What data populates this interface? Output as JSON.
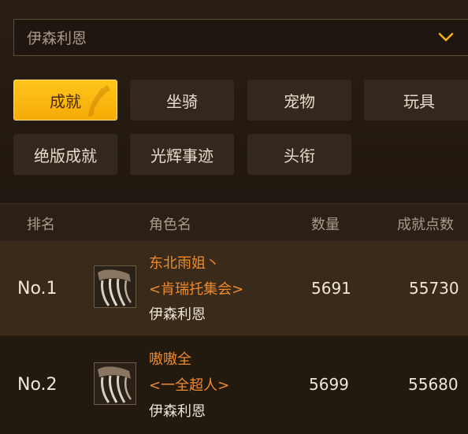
{
  "server_select": {
    "value": "伊森利恩",
    "icon": "chevron-down-icon"
  },
  "tabs": [
    {
      "label": "成就",
      "active": true
    },
    {
      "label": "坐骑",
      "active": false
    },
    {
      "label": "宠物",
      "active": false
    },
    {
      "label": "玩具",
      "active": false
    },
    {
      "label": "绝版成就",
      "active": false
    },
    {
      "label": "光辉事迹",
      "active": false
    },
    {
      "label": "头衔",
      "active": false
    }
  ],
  "table": {
    "headers": {
      "rank": "排名",
      "character": "角色名",
      "count": "数量",
      "points": "成就点数"
    },
    "rows": [
      {
        "rank": "No.1",
        "name": "东北雨姐丶",
        "guild": "<肯瑞托集会>",
        "server": "伊森利恩",
        "count": "5691",
        "points": "55730"
      },
      {
        "rank": "No.2",
        "name": "嗷嗷全",
        "guild": "<一全超人>",
        "server": "伊森利恩",
        "count": "5699",
        "points": "55680"
      }
    ]
  },
  "colors": {
    "accent": "#f5ab05",
    "name_orange": "#f08a2a",
    "background": "#22190f"
  }
}
